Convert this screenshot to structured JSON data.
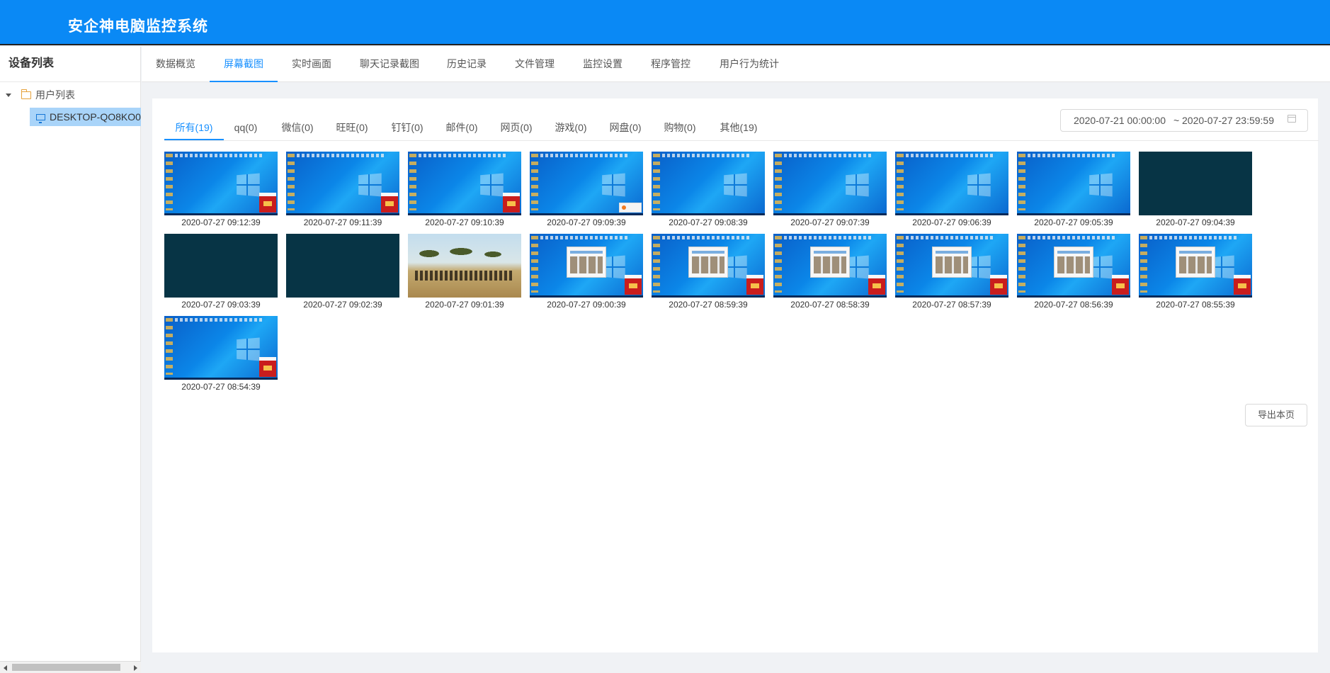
{
  "app": {
    "title": "安企神电脑监控系统"
  },
  "sidebar": {
    "title": "设备列表",
    "tree": {
      "root_label": "用户列表",
      "device_label": "DESKTOP-QO8KO0"
    }
  },
  "nav": {
    "tabs": [
      "数据概览",
      "屏幕截图",
      "实时画面",
      "聊天记录截图",
      "历史记录",
      "文件管理",
      "监控设置",
      "程序管控",
      "用户行为统计"
    ],
    "active": "屏幕截图"
  },
  "filter": {
    "tabs": [
      "所有(19)",
      "qq(0)",
      "微信(0)",
      "旺旺(0)",
      "钉钉(0)",
      "邮件(0)",
      "网页(0)",
      "游戏(0)",
      "网盘(0)",
      "购物(0)",
      "其他(19)"
    ],
    "active": "所有(19)",
    "date_start": "2020-07-21 00:00:00",
    "date_sep": "~",
    "date_end": "2020-07-27 23:59:59"
  },
  "screenshots": [
    {
      "time": "2020-07-27 09:12:39",
      "kind": "desktop",
      "popup": "red"
    },
    {
      "time": "2020-07-27 09:11:39",
      "kind": "desktop",
      "popup": "red"
    },
    {
      "time": "2020-07-27 09:10:39",
      "kind": "desktop",
      "popup": "red"
    },
    {
      "time": "2020-07-27 09:09:39",
      "kind": "desktop",
      "popup": "white"
    },
    {
      "time": "2020-07-27 09:08:39",
      "kind": "desktop",
      "popup": "none"
    },
    {
      "time": "2020-07-27 09:07:39",
      "kind": "desktop",
      "popup": "none"
    },
    {
      "time": "2020-07-27 09:06:39",
      "kind": "desktop",
      "popup": "none"
    },
    {
      "time": "2020-07-27 09:05:39",
      "kind": "desktop",
      "popup": "none"
    },
    {
      "time": "2020-07-27 09:04:39",
      "kind": "dark",
      "popup": "none"
    },
    {
      "time": "2020-07-27 09:03:39",
      "kind": "dark",
      "popup": "none"
    },
    {
      "time": "2020-07-27 09:02:39",
      "kind": "dark",
      "popup": "none"
    },
    {
      "time": "2020-07-27 09:01:39",
      "kind": "savanna",
      "popup": "none"
    },
    {
      "time": "2020-07-27 09:00:39",
      "kind": "browser",
      "popup": "red"
    },
    {
      "time": "2020-07-27 08:59:39",
      "kind": "browser",
      "popup": "red"
    },
    {
      "time": "2020-07-27 08:58:39",
      "kind": "browser",
      "popup": "red"
    },
    {
      "time": "2020-07-27 08:57:39",
      "kind": "browser",
      "popup": "red"
    },
    {
      "time": "2020-07-27 08:56:39",
      "kind": "browser",
      "popup": "red"
    },
    {
      "time": "2020-07-27 08:55:39",
      "kind": "browser",
      "popup": "red"
    },
    {
      "time": "2020-07-27 08:54:39",
      "kind": "desktop",
      "popup": "red"
    }
  ],
  "actions": {
    "export_label": "导出本页"
  },
  "colors": {
    "header": "#0a89f5",
    "accent": "#1890ff",
    "selected_row": "#a9d4f9"
  }
}
